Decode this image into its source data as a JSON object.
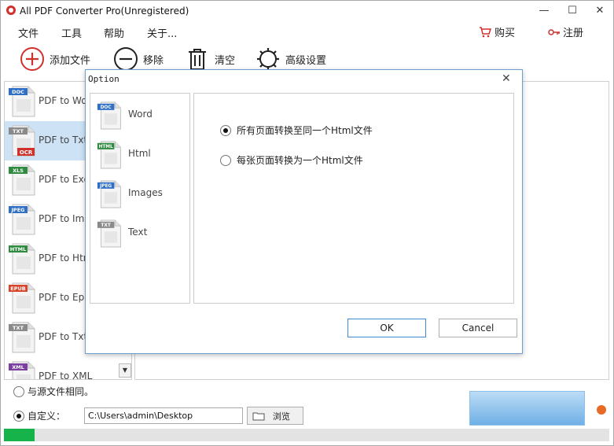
{
  "window": {
    "title": "All PDF Converter Pro(Unregistered)",
    "controls": {
      "minimize": "—",
      "maximize": "☐",
      "close": "✕"
    }
  },
  "menu": {
    "items": [
      "文件",
      "工具",
      "帮助",
      "关于..."
    ],
    "buy": "购买",
    "register": "注册"
  },
  "toolbar": {
    "add": "添加文件",
    "remove": "移除",
    "clear": "清空",
    "advanced": "高级设置"
  },
  "formats": [
    {
      "tag": "DOC",
      "tag_color": "#2f6fc6",
      "label": "PDF to Word",
      "selected": false
    },
    {
      "tag": "TXT",
      "tag_color": "#8a8a8a",
      "label": "PDF to Txt",
      "badge": "OCR",
      "selected": true
    },
    {
      "tag": "XLS",
      "tag_color": "#2e8b3f",
      "label": "PDF to Excel",
      "selected": false
    },
    {
      "tag": "JPEG",
      "tag_color": "#2f6fc6",
      "label": "PDF to Image",
      "selected": false
    },
    {
      "tag": "HTML",
      "tag_color": "#2e8b3f",
      "label": "PDF to Html",
      "selected": false
    },
    {
      "tag": "EPUB",
      "tag_color": "#d9452a",
      "label": "PDF to Epub",
      "selected": false
    },
    {
      "tag": "TXT",
      "tag_color": "#8a8a8a",
      "label": "PDF to Txt",
      "selected": false
    },
    {
      "tag": "XML",
      "tag_color": "#7a3fa0",
      "label": "PDF to XML",
      "selected": false
    }
  ],
  "output": {
    "same_as_source": "与源文件相同。",
    "custom": "自定义：",
    "path": "C:\\Users\\admin\\Desktop",
    "browse": "浏览",
    "selected_option": "custom"
  },
  "progress": {
    "fraction": 0.05
  },
  "dialog": {
    "title": "Option",
    "close": "✕",
    "tabs": [
      {
        "tag": "DOC",
        "tag_color": "#2f6fc6",
        "label": "Word"
      },
      {
        "tag": "HTML",
        "tag_color": "#2e8b3f",
        "label": "Html"
      },
      {
        "tag": "JPEG",
        "tag_color": "#2f6fc6",
        "label": "Images"
      },
      {
        "tag": "TXT",
        "tag_color": "#8a8a8a",
        "label": "Text"
      }
    ],
    "options": [
      {
        "label": "所有页面转换至同一个Html文件",
        "checked": true
      },
      {
        "label": "每张页面转换为一个Html文件",
        "checked": false
      }
    ],
    "ok": "OK",
    "cancel": "Cancel"
  }
}
